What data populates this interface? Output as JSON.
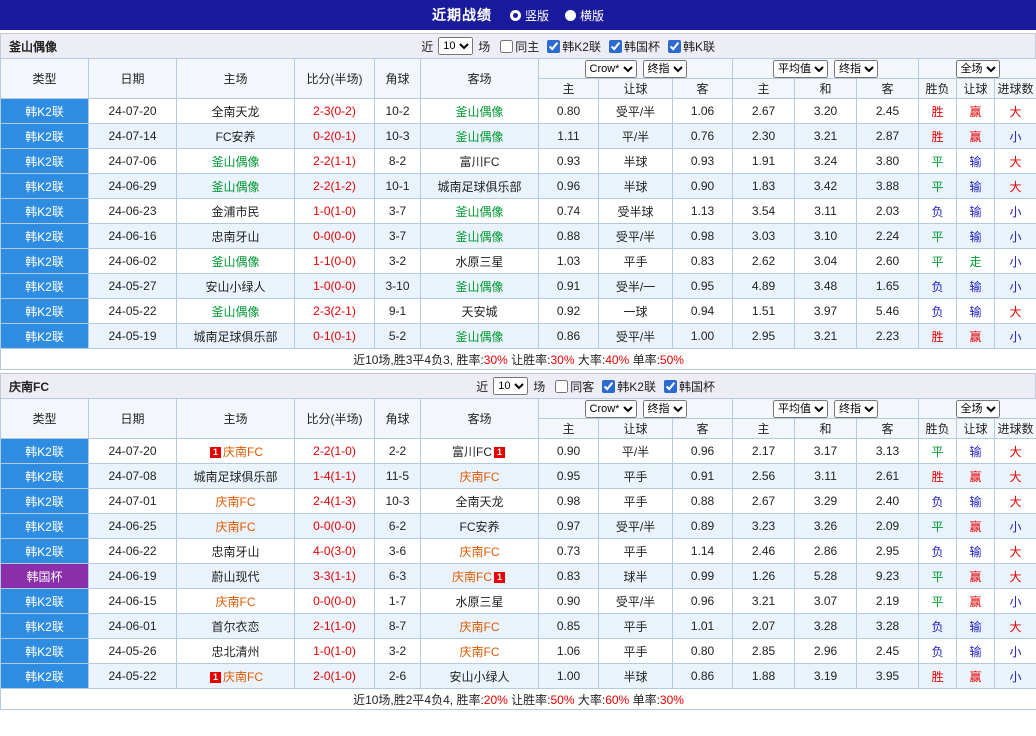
{
  "title_bar": {
    "title": "近期战绩",
    "layout_options": [
      {
        "label": "竖版",
        "selected": true
      },
      {
        "label": "横版",
        "selected": false
      }
    ]
  },
  "columns": {
    "main": [
      "类型",
      "日期",
      "主场",
      "比分(半场)",
      "角球",
      "客场"
    ],
    "odds_sub": [
      "主",
      "让球",
      "客"
    ],
    "euro_sub": [
      "主",
      "和",
      "客"
    ],
    "result_sub": [
      "胜负",
      "让球",
      "进球数"
    ]
  },
  "colors": {
    "league_blue": "#2E8DE0",
    "cup_purple": "#8A2FA8",
    "score_red": "#E60000",
    "win_red": "#E60000",
    "draw_green": "#009933",
    "lose_blue": "#2020C0",
    "team_green": "#009933",
    "team_orange": "#E05A00"
  },
  "sections": [
    {
      "team": "釜山偶像",
      "team_highlight": "green",
      "recent": {
        "label_before": "近",
        "count": "10",
        "label_after": "场"
      },
      "checkboxes": [
        {
          "label": "同主",
          "checked": false
        },
        {
          "label": "韩K2联",
          "checked": true
        },
        {
          "label": "韩国杯",
          "checked": true
        },
        {
          "label": "韩K联",
          "checked": true
        }
      ],
      "selects": {
        "asia_source": "Crow*",
        "asia_type": "终指",
        "euro_source": "平均值",
        "euro_type": "终指",
        "scope": "全场"
      },
      "rows": [
        {
          "league": "韩K2联",
          "cup": false,
          "date": "24-07-20",
          "home": "全南天龙",
          "home_subject": false,
          "home_card": "",
          "score": "2-3(0-2)",
          "corner": "10-2",
          "away": "釜山偶像",
          "away_subject": true,
          "away_card": "",
          "asia": [
            "0.80",
            "受平/半",
            "1.06"
          ],
          "euro": [
            "2.67",
            "3.20",
            "2.45"
          ],
          "result": "胜",
          "handicap": "赢",
          "goals": "大"
        },
        {
          "league": "韩K2联",
          "cup": false,
          "date": "24-07-14",
          "home": "FC安养",
          "home_subject": false,
          "home_card": "",
          "score": "0-2(0-1)",
          "corner": "10-3",
          "away": "釜山偶像",
          "away_subject": true,
          "away_card": "",
          "asia": [
            "1.11",
            "平/半",
            "0.76"
          ],
          "euro": [
            "2.30",
            "3.21",
            "2.87"
          ],
          "result": "胜",
          "handicap": "赢",
          "goals": "小"
        },
        {
          "league": "韩K2联",
          "cup": false,
          "date": "24-07-06",
          "home": "釜山偶像",
          "home_subject": true,
          "home_card": "",
          "score": "2-2(1-1)",
          "corner": "8-2",
          "away": "富川FC",
          "away_subject": false,
          "away_card": "",
          "asia": [
            "0.93",
            "半球",
            "0.93"
          ],
          "euro": [
            "1.91",
            "3.24",
            "3.80"
          ],
          "result": "平",
          "handicap": "输",
          "goals": "大"
        },
        {
          "league": "韩K2联",
          "cup": false,
          "date": "24-06-29",
          "home": "釜山偶像",
          "home_subject": true,
          "home_card": "",
          "score": "2-2(1-2)",
          "corner": "10-1",
          "away": "城南足球俱乐部",
          "away_subject": false,
          "away_card": "",
          "asia": [
            "0.96",
            "半球",
            "0.90"
          ],
          "euro": [
            "1.83",
            "3.42",
            "3.88"
          ],
          "result": "平",
          "handicap": "输",
          "goals": "大"
        },
        {
          "league": "韩K2联",
          "cup": false,
          "date": "24-06-23",
          "home": "金浦市民",
          "home_subject": false,
          "home_card": "",
          "score": "1-0(1-0)",
          "corner": "3-7",
          "away": "釜山偶像",
          "away_subject": true,
          "away_card": "",
          "asia": [
            "0.74",
            "受半球",
            "1.13"
          ],
          "euro": [
            "3.54",
            "3.11",
            "2.03"
          ],
          "result": "负",
          "handicap": "输",
          "goals": "小"
        },
        {
          "league": "韩K2联",
          "cup": false,
          "date": "24-06-16",
          "home": "忠南牙山",
          "home_subject": false,
          "home_card": "",
          "score": "0-0(0-0)",
          "corner": "3-7",
          "away": "釜山偶像",
          "away_subject": true,
          "away_card": "",
          "asia": [
            "0.88",
            "受平/半",
            "0.98"
          ],
          "euro": [
            "3.03",
            "3.10",
            "2.24"
          ],
          "result": "平",
          "handicap": "输",
          "goals": "小"
        },
        {
          "league": "韩K2联",
          "cup": false,
          "date": "24-06-02",
          "home": "釜山偶像",
          "home_subject": true,
          "home_card": "",
          "score": "1-1(0-0)",
          "corner": "3-2",
          "away": "水原三星",
          "away_subject": false,
          "away_card": "",
          "asia": [
            "1.03",
            "平手",
            "0.83"
          ],
          "euro": [
            "2.62",
            "3.04",
            "2.60"
          ],
          "result": "平",
          "handicap": "走",
          "goals": "小"
        },
        {
          "league": "韩K2联",
          "cup": false,
          "date": "24-05-27",
          "home": "安山小绿人",
          "home_subject": false,
          "home_card": "",
          "score": "1-0(0-0)",
          "corner": "3-10",
          "away": "釜山偶像",
          "away_subject": true,
          "away_card": "",
          "asia": [
            "0.91",
            "受半/一",
            "0.95"
          ],
          "euro": [
            "4.89",
            "3.48",
            "1.65"
          ],
          "result": "负",
          "handicap": "输",
          "goals": "小"
        },
        {
          "league": "韩K2联",
          "cup": false,
          "date": "24-05-22",
          "home": "釜山偶像",
          "home_subject": true,
          "home_card": "",
          "score": "2-3(2-1)",
          "corner": "9-1",
          "away": "天安城",
          "away_subject": false,
          "away_card": "",
          "asia": [
            "0.92",
            "一球",
            "0.94"
          ],
          "euro": [
            "1.51",
            "3.97",
            "5.46"
          ],
          "result": "负",
          "handicap": "输",
          "goals": "大"
        },
        {
          "league": "韩K2联",
          "cup": false,
          "date": "24-05-19",
          "home": "城南足球俱乐部",
          "home_subject": false,
          "home_card": "",
          "score": "0-1(0-1)",
          "corner": "5-2",
          "away": "釜山偶像",
          "away_subject": true,
          "away_card": "",
          "asia": [
            "0.86",
            "受平/半",
            "1.00"
          ],
          "euro": [
            "2.95",
            "3.21",
            "2.23"
          ],
          "result": "胜",
          "handicap": "赢",
          "goals": "小"
        }
      ],
      "summary": [
        {
          "text": "近10场,胜3平4负3, 胜率:",
          "red": false
        },
        {
          "text": "30%",
          "red": true
        },
        {
          "text": " 让胜率:",
          "red": false
        },
        {
          "text": "30%",
          "red": true
        },
        {
          "text": " 大率:",
          "red": false
        },
        {
          "text": "40%",
          "red": true
        },
        {
          "text": " 单率:",
          "red": false
        },
        {
          "text": "50%",
          "red": true
        }
      ]
    },
    {
      "team": "庆南FC",
      "team_highlight": "orange",
      "recent": {
        "label_before": "近",
        "count": "10",
        "label_after": "场"
      },
      "checkboxes": [
        {
          "label": "同客",
          "checked": false
        },
        {
          "label": "韩K2联",
          "checked": true
        },
        {
          "label": "韩国杯",
          "checked": true
        }
      ],
      "selects": {
        "asia_source": "Crow*",
        "asia_type": "终指",
        "euro_source": "平均值",
        "euro_type": "终指",
        "scope": "全场"
      },
      "rows": [
        {
          "league": "韩K2联",
          "cup": false,
          "date": "24-07-20",
          "home": "庆南FC",
          "home_subject": true,
          "home_card": "1",
          "score": "2-2(1-0)",
          "corner": "2-2",
          "away": "富川FC",
          "away_subject": false,
          "away_card": "1",
          "asia": [
            "0.90",
            "平/半",
            "0.96"
          ],
          "euro": [
            "2.17",
            "3.17",
            "3.13"
          ],
          "result": "平",
          "handicap": "输",
          "goals": "大"
        },
        {
          "league": "韩K2联",
          "cup": false,
          "date": "24-07-08",
          "home": "城南足球俱乐部",
          "home_subject": false,
          "home_card": "",
          "score": "1-4(1-1)",
          "corner": "11-5",
          "away": "庆南FC",
          "away_subject": true,
          "away_card": "",
          "asia": [
            "0.95",
            "平手",
            "0.91"
          ],
          "euro": [
            "2.56",
            "3.11",
            "2.61"
          ],
          "result": "胜",
          "handicap": "赢",
          "goals": "大"
        },
        {
          "league": "韩K2联",
          "cup": false,
          "date": "24-07-01",
          "home": "庆南FC",
          "home_subject": true,
          "home_card": "",
          "score": "2-4(1-3)",
          "corner": "10-3",
          "away": "全南天龙",
          "away_subject": false,
          "away_card": "",
          "asia": [
            "0.98",
            "平手",
            "0.88"
          ],
          "euro": [
            "2.67",
            "3.29",
            "2.40"
          ],
          "result": "负",
          "handicap": "输",
          "goals": "大"
        },
        {
          "league": "韩K2联",
          "cup": false,
          "date": "24-06-25",
          "home": "庆南FC",
          "home_subject": true,
          "home_card": "",
          "score": "0-0(0-0)",
          "corner": "6-2",
          "away": "FC安养",
          "away_subject": false,
          "away_card": "",
          "asia": [
            "0.97",
            "受平/半",
            "0.89"
          ],
          "euro": [
            "3.23",
            "3.26",
            "2.09"
          ],
          "result": "平",
          "handicap": "赢",
          "goals": "小"
        },
        {
          "league": "韩K2联",
          "cup": false,
          "date": "24-06-22",
          "home": "忠南牙山",
          "home_subject": false,
          "home_card": "",
          "score": "4-0(3-0)",
          "corner": "3-6",
          "away": "庆南FC",
          "away_subject": true,
          "away_card": "",
          "asia": [
            "0.73",
            "平手",
            "1.14"
          ],
          "euro": [
            "2.46",
            "2.86",
            "2.95"
          ],
          "result": "负",
          "handicap": "输",
          "goals": "大"
        },
        {
          "league": "韩国杯",
          "cup": true,
          "date": "24-06-19",
          "home": "蔚山现代",
          "home_subject": false,
          "home_card": "",
          "score": "3-3(1-1)",
          "corner": "6-3",
          "away": "庆南FC",
          "away_subject": true,
          "away_card": "1",
          "asia": [
            "0.83",
            "球半",
            "0.99"
          ],
          "euro": [
            "1.26",
            "5.28",
            "9.23"
          ],
          "result": "平",
          "handicap": "赢",
          "goals": "大"
        },
        {
          "league": "韩K2联",
          "cup": false,
          "date": "24-06-15",
          "home": "庆南FC",
          "home_subject": true,
          "home_card": "",
          "score": "0-0(0-0)",
          "corner": "1-7",
          "away": "水原三星",
          "away_subject": false,
          "away_card": "",
          "asia": [
            "0.90",
            "受平/半",
            "0.96"
          ],
          "euro": [
            "3.21",
            "3.07",
            "2.19"
          ],
          "result": "平",
          "handicap": "赢",
          "goals": "小"
        },
        {
          "league": "韩K2联",
          "cup": false,
          "date": "24-06-01",
          "home": "首尔衣恋",
          "home_subject": false,
          "home_card": "",
          "score": "2-1(1-0)",
          "corner": "8-7",
          "away": "庆南FC",
          "away_subject": true,
          "away_card": "",
          "asia": [
            "0.85",
            "平手",
            "1.01"
          ],
          "euro": [
            "2.07",
            "3.28",
            "3.28"
          ],
          "result": "负",
          "handicap": "输",
          "goals": "大"
        },
        {
          "league": "韩K2联",
          "cup": false,
          "date": "24-05-26",
          "home": "忠北清州",
          "home_subject": false,
          "home_card": "",
          "score": "1-0(1-0)",
          "corner": "3-2",
          "away": "庆南FC",
          "away_subject": true,
          "away_card": "",
          "asia": [
            "1.06",
            "平手",
            "0.80"
          ],
          "euro": [
            "2.85",
            "2.96",
            "2.45"
          ],
          "result": "负",
          "handicap": "输",
          "goals": "小"
        },
        {
          "league": "韩K2联",
          "cup": false,
          "date": "24-05-22",
          "home": "庆南FC",
          "home_subject": true,
          "home_card": "1",
          "score": "2-0(1-0)",
          "corner": "2-6",
          "away": "安山小绿人",
          "away_subject": false,
          "away_card": "",
          "asia": [
            "1.00",
            "半球",
            "0.86"
          ],
          "euro": [
            "1.88",
            "3.19",
            "3.95"
          ],
          "result": "胜",
          "handicap": "赢",
          "goals": "小"
        }
      ],
      "summary": [
        {
          "text": "近10场,胜2平4负4, 胜率:",
          "red": false
        },
        {
          "text": "20%",
          "red": true
        },
        {
          "text": " 让胜率:",
          "red": false
        },
        {
          "text": "50%",
          "red": true
        },
        {
          "text": " 大率:",
          "red": false
        },
        {
          "text": "60%",
          "red": true
        },
        {
          "text": " 单率:",
          "red": false
        },
        {
          "text": "30%",
          "red": true
        }
      ]
    }
  ]
}
